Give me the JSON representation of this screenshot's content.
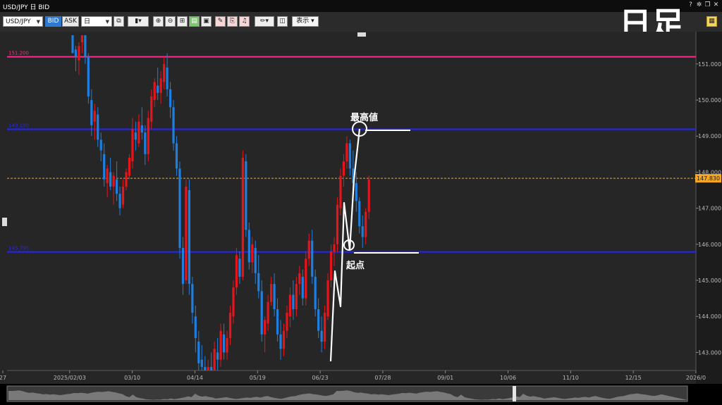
{
  "window": {
    "title": "USD/JPY 日 BID"
  },
  "toolbar": {
    "symbol": "USD/JPY",
    "bid_label": "BID",
    "ask_label": "ASK",
    "period": "日",
    "display_label": "表示"
  },
  "overlay": {
    "big_label": "日足",
    "peak_label": "最高値",
    "start_label": "起点"
  },
  "hlines": [
    {
      "value": 151.2,
      "label": "151.200",
      "color": "#ff2a8a"
    },
    {
      "value": 149.19,
      "label": "149.190",
      "color": "#2323ff"
    },
    {
      "value": 145.79,
      "label": "145.790",
      "color": "#2323ff"
    }
  ],
  "current_price": {
    "value": 147.83,
    "label": "147.830",
    "color": "#f5a623"
  },
  "chart_data": {
    "type": "candlestick",
    "title": "",
    "ylim": [
      142.5,
      151.7
    ],
    "y_ticks": [
      {
        "value": 151,
        "label": "151.000"
      },
      {
        "value": 150,
        "label": "150.000"
      },
      {
        "value": 149,
        "label": "149.000"
      },
      {
        "value": 148,
        "label": "148.000"
      },
      {
        "value": 147,
        "label": "147.000"
      },
      {
        "value": 146,
        "label": "146.000"
      },
      {
        "value": 145,
        "label": "145.000"
      },
      {
        "value": 144,
        "label": "144.000"
      },
      {
        "value": 143,
        "label": "143.000"
      }
    ],
    "x_ticks": [
      "27",
      "2025/02/03",
      "03/10",
      "04/14",
      "05/19",
      "06/23",
      "07/28",
      "09/01",
      "10/06",
      "11/10",
      "12/15",
      "2026/0"
    ],
    "up_color": "#e8141b",
    "down_color": "#1e7fe0",
    "candles": [
      [
        152.1,
        152.5,
        151.6,
        151.3
      ],
      [
        151.4,
        151.5,
        150.8,
        151.2
      ],
      [
        151.1,
        151.6,
        150.7,
        151.5
      ],
      [
        151.6,
        152.0,
        151.3,
        151.8
      ],
      [
        151.8,
        152.0,
        151.0,
        151.2
      ],
      [
        151.2,
        151.3,
        149.9,
        150.1
      ],
      [
        150.0,
        150.3,
        149.0,
        149.3
      ],
      [
        149.4,
        149.9,
        148.9,
        149.7
      ],
      [
        149.6,
        149.8,
        148.7,
        148.9
      ],
      [
        148.9,
        149.1,
        148.3,
        148.6
      ],
      [
        148.5,
        148.8,
        147.6,
        147.8
      ],
      [
        147.7,
        148.2,
        147.3,
        148.1
      ],
      [
        148.0,
        148.4,
        147.5,
        147.6
      ],
      [
        147.6,
        148.0,
        147.1,
        147.9
      ],
      [
        147.8,
        148.3,
        147.2,
        147.4
      ],
      [
        147.4,
        147.6,
        146.8,
        147.0
      ],
      [
        147.1,
        147.8,
        147.0,
        147.6
      ],
      [
        147.6,
        148.1,
        147.5,
        148.0
      ],
      [
        147.9,
        148.5,
        147.8,
        148.4
      ],
      [
        148.3,
        149.5,
        148.1,
        149.2
      ],
      [
        149.1,
        149.4,
        148.6,
        148.9
      ],
      [
        148.8,
        149.6,
        148.7,
        149.4
      ],
      [
        149.3,
        149.8,
        148.9,
        149.1
      ],
      [
        149.1,
        149.3,
        148.2,
        148.5
      ],
      [
        148.5,
        149.7,
        148.3,
        149.5
      ],
      [
        149.4,
        150.3,
        149.2,
        150.1
      ],
      [
        150.0,
        150.6,
        149.8,
        150.5
      ],
      [
        150.4,
        150.9,
        150.0,
        150.2
      ],
      [
        150.2,
        150.8,
        149.9,
        150.6
      ],
      [
        150.5,
        151.2,
        150.3,
        151.0
      ],
      [
        150.9,
        151.3,
        150.1,
        150.3
      ],
      [
        150.3,
        150.5,
        149.5,
        149.8
      ],
      [
        149.8,
        150.0,
        148.6,
        148.8
      ],
      [
        148.8,
        149.0,
        147.9,
        148.1
      ],
      [
        148.1,
        148.3,
        145.6,
        145.9
      ],
      [
        145.9,
        146.2,
        144.6,
        144.9
      ],
      [
        145.0,
        147.8,
        144.9,
        147.6
      ],
      [
        147.5,
        147.8,
        144.6,
        144.9
      ],
      [
        144.9,
        145.1,
        143.8,
        144.1
      ],
      [
        144.0,
        144.3,
        143.0,
        143.4
      ],
      [
        143.3,
        143.6,
        142.4,
        142.7
      ],
      [
        142.8,
        143.2,
        142.3,
        142.6
      ],
      [
        142.6,
        142.9,
        142.1,
        142.3
      ],
      [
        142.3,
        142.8,
        142.2,
        142.6
      ],
      [
        142.6,
        143.0,
        142.2,
        142.4
      ],
      [
        142.4,
        143.3,
        142.3,
        143.1
      ],
      [
        143.0,
        143.4,
        142.5,
        142.8
      ],
      [
        142.8,
        143.8,
        142.6,
        143.6
      ],
      [
        143.5,
        143.8,
        142.8,
        143.0
      ],
      [
        143.0,
        143.6,
        142.8,
        143.4
      ],
      [
        143.4,
        144.3,
        143.2,
        144.1
      ],
      [
        144.0,
        145.0,
        143.8,
        144.8
      ],
      [
        144.8,
        145.9,
        144.6,
        145.7
      ],
      [
        145.6,
        145.8,
        144.9,
        145.1
      ],
      [
        145.1,
        148.6,
        145.0,
        148.4
      ],
      [
        148.3,
        148.5,
        146.2,
        146.4
      ],
      [
        146.4,
        146.6,
        145.3,
        145.5
      ],
      [
        145.5,
        146.2,
        145.2,
        146.0
      ],
      [
        145.9,
        146.1,
        144.9,
        145.2
      ],
      [
        145.2,
        145.7,
        144.5,
        144.7
      ],
      [
        144.7,
        145.0,
        143.3,
        143.5
      ],
      [
        143.5,
        144.0,
        143.0,
        143.9
      ],
      [
        143.8,
        144.6,
        143.6,
        144.4
      ],
      [
        144.4,
        145.1,
        144.3,
        144.9
      ],
      [
        144.9,
        145.2,
        144.0,
        144.2
      ],
      [
        144.2,
        144.5,
        143.3,
        143.5
      ],
      [
        143.5,
        143.9,
        142.8,
        143.1
      ],
      [
        143.1,
        143.8,
        142.9,
        143.6
      ],
      [
        143.6,
        144.3,
        143.4,
        144.1
      ],
      [
        144.0,
        144.8,
        143.7,
        144.6
      ],
      [
        144.6,
        145.0,
        143.9,
        144.2
      ],
      [
        144.2,
        145.1,
        144.0,
        144.9
      ],
      [
        144.9,
        145.4,
        144.6,
        145.2
      ],
      [
        145.1,
        145.3,
        144.3,
        144.5
      ],
      [
        144.5,
        145.8,
        144.3,
        145.6
      ],
      [
        145.6,
        146.3,
        145.4,
        146.1
      ],
      [
        146.1,
        146.4,
        144.9,
        145.1
      ],
      [
        145.1,
        145.3,
        144.0,
        144.2
      ],
      [
        144.2,
        144.5,
        143.4,
        143.6
      ],
      [
        143.6,
        144.0,
        143.0,
        143.3
      ],
      [
        143.3,
        144.3,
        143.1,
        144.1
      ],
      [
        144.0,
        145.2,
        143.9,
        145.0
      ],
      [
        145.0,
        146.0,
        144.8,
        145.8
      ],
      [
        145.8,
        146.2,
        145.4,
        146.0
      ],
      [
        146.0,
        147.3,
        145.8,
        147.1
      ],
      [
        147.0,
        148.1,
        146.8,
        147.9
      ],
      [
        147.9,
        148.5,
        147.6,
        148.3
      ],
      [
        148.3,
        149.0,
        148.1,
        148.8
      ],
      [
        148.8,
        148.9,
        147.9,
        148.1
      ],
      [
        148.1,
        148.6,
        147.5,
        147.7
      ],
      [
        147.7,
        148.0,
        146.9,
        147.2
      ],
      [
        147.2,
        147.3,
        146.3,
        146.5
      ],
      [
        146.5,
        146.8,
        145.9,
        146.2
      ],
      [
        146.2,
        147.0,
        146.0,
        146.9
      ],
      [
        146.9,
        147.9,
        146.7,
        147.8
      ]
    ]
  }
}
